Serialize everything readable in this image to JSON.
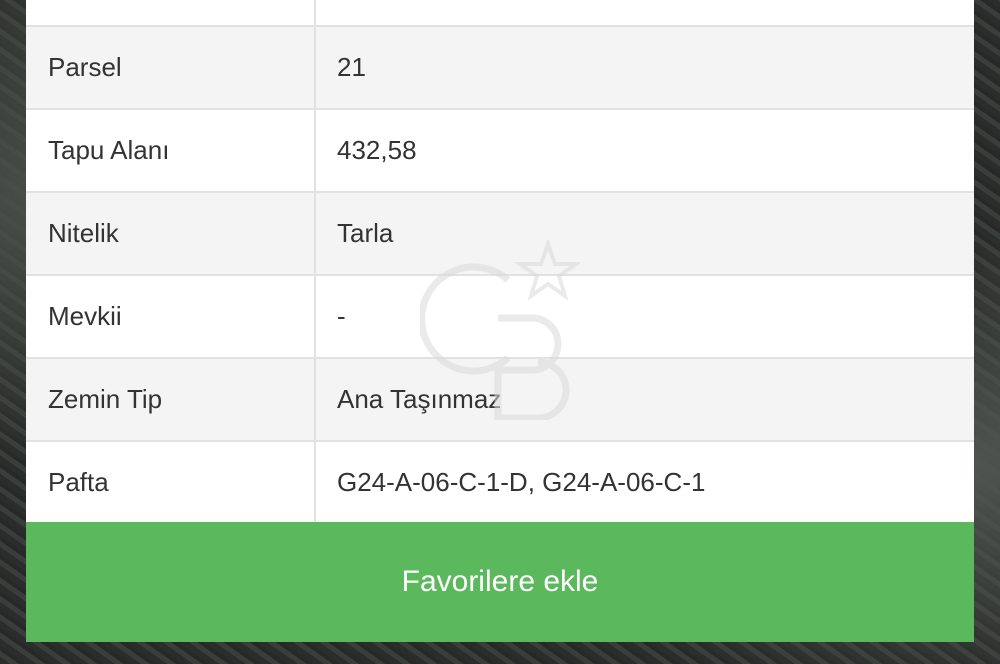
{
  "table": {
    "rows": [
      {
        "label": "",
        "value": ""
      },
      {
        "label": "Parsel",
        "value": "21"
      },
      {
        "label": "Tapu Alanı",
        "value": "432,58"
      },
      {
        "label": "Nitelik",
        "value": "Tarla"
      },
      {
        "label": "Mevkii",
        "value": "-"
      },
      {
        "label": "Zemin Tip",
        "value": "Ana Taşınmaz"
      },
      {
        "label": "Pafta",
        "value": "G24-A-06-C-1-D, G24-A-06-C-1"
      }
    ]
  },
  "actions": {
    "favorite_label": "Favorilere ekle"
  },
  "watermark": {
    "brand": "CB",
    "icon": "star-icon"
  },
  "colors": {
    "accent": "#5cb85c",
    "row_alt": "#f4f4f4",
    "border": "#e2e2e2"
  }
}
